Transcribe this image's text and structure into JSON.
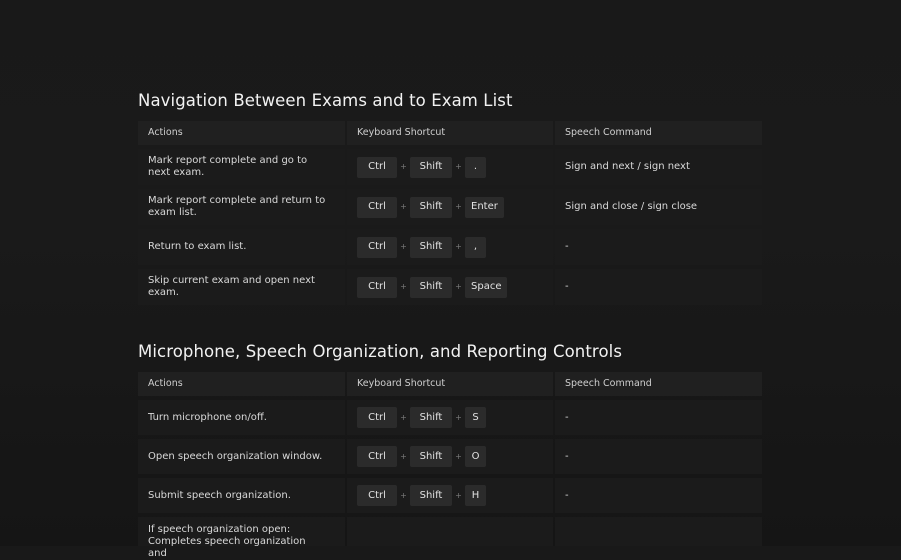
{
  "columns": {
    "actions": "Actions",
    "shortcut": "Keyboard Shortcut",
    "speech": "Speech Command"
  },
  "sections": [
    {
      "title": "Navigation Between Exams and to Exam List",
      "rows": [
        {
          "action": "Mark report complete and go to next exam.",
          "keys": [
            "Ctrl",
            "Shift",
            "."
          ],
          "speech": "Sign and next / sign next"
        },
        {
          "action": "Mark report complete and return to exam list.",
          "keys": [
            "Ctrl",
            "Shift",
            "Enter"
          ],
          "speech": "Sign and close / sign close"
        },
        {
          "action": "Return to exam list.",
          "keys": [
            "Ctrl",
            "Shift",
            ","
          ],
          "speech": "-"
        },
        {
          "action": "Skip current exam and open next exam.",
          "keys": [
            "Ctrl",
            "Shift",
            "Space"
          ],
          "speech": "-"
        }
      ]
    },
    {
      "title": "Microphone, Speech Organization, and Reporting Controls",
      "rows": [
        {
          "action": "Turn microphone on/off.",
          "keys": [
            "Ctrl",
            "Shift",
            "S"
          ],
          "speech": "-"
        },
        {
          "action": "Open speech organization window.",
          "keys": [
            "Ctrl",
            "Shift",
            "O"
          ],
          "speech": "-"
        },
        {
          "action": "Submit speech organization.",
          "keys": [
            "Ctrl",
            "Shift",
            "H"
          ],
          "speech": "-"
        },
        {
          "action": "If speech organization open: Completes speech organization and",
          "keys": [
            "",
            "",
            ""
          ],
          "speech": ""
        }
      ]
    }
  ],
  "plus_glyph": "+"
}
